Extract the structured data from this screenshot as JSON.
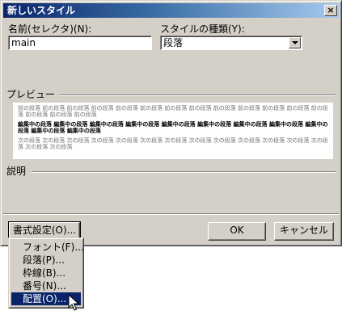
{
  "window": {
    "title": "新しいスタイル",
    "close_glyph": "×"
  },
  "name_field": {
    "label": "名前(セレクタ)(N):",
    "value": "main"
  },
  "style_type": {
    "label": "スタイルの種類(Y):",
    "value": "段落"
  },
  "preview": {
    "label": "プレビュー",
    "prev_paragraph": "前の段落 前の段落 前の段落 前の段落 前の段落 前の段落 前の段落 前の段落 前の段落 前の段落 前の段落 前の段落 前の段落 前の段落 前の段落 前の段落",
    "current_paragraph": "編集中の段落 編集中の段落 編集中の段落 編集中の段落 編集中の段落 編集中の段落 編集中の段落 編集中の段落 編集中の段落 編集中の段落 編集中の段落",
    "next_paragraph": "次の段落 次の段落 次の段落 次の段落 次の段落 次の段落 次の段落 次の段落 次の段落 次の段落 次の段落 次の段落 次の段落 次の段落 次の段落"
  },
  "description": {
    "label": "説明"
  },
  "buttons": {
    "format": "書式設定(O)...",
    "ok": "OK",
    "cancel": "キャンセル"
  },
  "format_menu": {
    "items": [
      "フォント(F)...",
      "段落(P)...",
      "枠線(B)...",
      "番号(N)...",
      "配置(O)..."
    ],
    "selected_index": 4
  }
}
